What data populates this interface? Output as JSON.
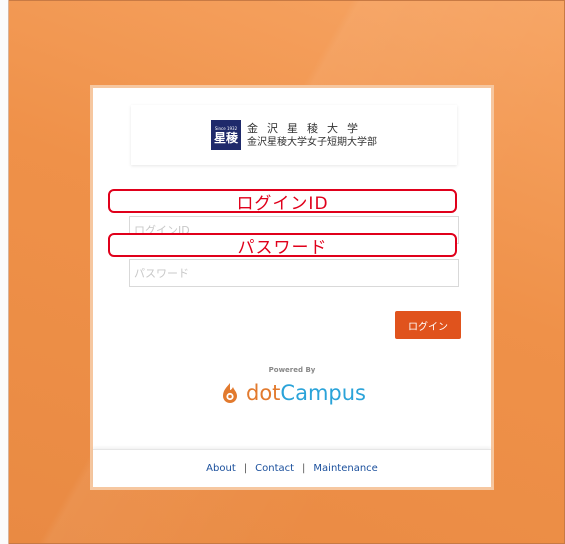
{
  "logo": {
    "mark_since": "Since 1932",
    "mark_kanji": "星稜",
    "line1": "金沢星稜大学",
    "line2": "金沢星稜大学女子短期大学部"
  },
  "form": {
    "id_placeholder": "ログインID",
    "pw_placeholder": "パスワード",
    "login_label": "ログイン"
  },
  "callouts": {
    "id_label": "ログインID",
    "pw_label": "パスワード"
  },
  "brand": {
    "powered_by": "Powered By",
    "name_dot": "dot",
    "name_campus": "Campus"
  },
  "footer": {
    "about": "About",
    "contact": "Contact",
    "maintenance": "Maintenance",
    "separator": "|"
  },
  "colors": {
    "background": "#ef9450",
    "login_button": "#e0531d",
    "callout_red": "#e0001b",
    "link_blue": "#1a4f9c",
    "campus_blue": "#2aa3d9"
  }
}
